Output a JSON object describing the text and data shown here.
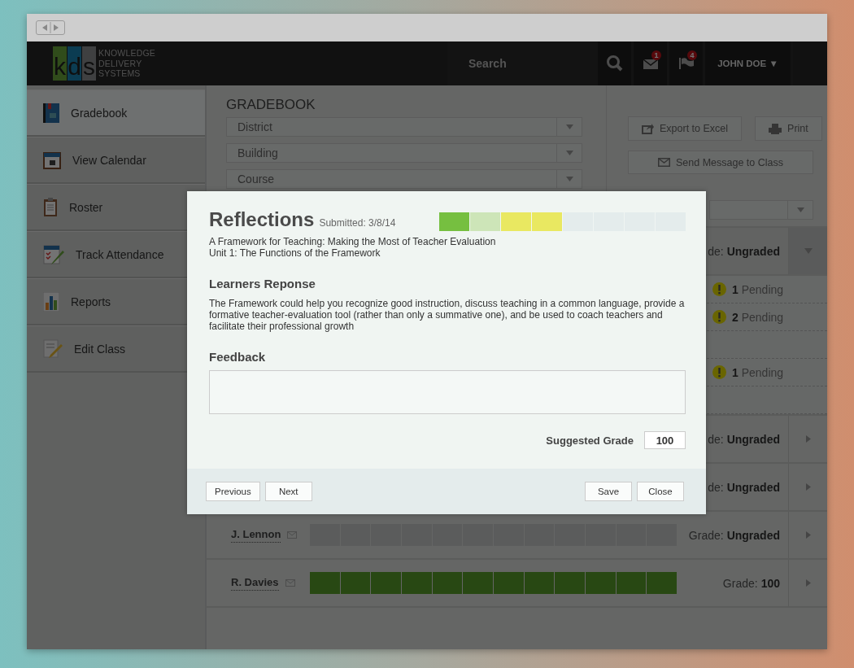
{
  "logo": {
    "letters": [
      "k",
      "d",
      "s"
    ],
    "tagline": [
      "KNOWLEDGE",
      "DELIVERY",
      "SYSTEMS"
    ]
  },
  "header": {
    "search": {
      "placeholder": "Search"
    },
    "messages_badge": "1",
    "flags_badge": "4",
    "user": "JOHN DOE",
    "user_caret": "▼"
  },
  "sidebar": {
    "items": [
      {
        "label": "Gradebook",
        "selected": true
      },
      {
        "label": "View Calendar",
        "selected": false
      },
      {
        "label": "Roster",
        "selected": false
      },
      {
        "label": "Track Attendance",
        "selected": false
      },
      {
        "label": "Reports",
        "selected": false
      },
      {
        "label": "Edit Class",
        "selected": false
      }
    ]
  },
  "gradebook": {
    "title": "GRADEBOOK",
    "filters": [
      {
        "placeholder": "District"
      },
      {
        "placeholder": "Building"
      },
      {
        "placeholder": "Course"
      }
    ],
    "actions": [
      {
        "label": "Export to Excel"
      },
      {
        "label": "Print"
      },
      {
        "label": "Send Message to Class"
      }
    ]
  },
  "students": [
    {
      "grade_label": "de:",
      "grade": "Ungraded",
      "expanded": true,
      "items": [
        {
          "kind": "pending",
          "count": "1",
          "label": "Pending"
        },
        {
          "kind": "pending",
          "count": "2",
          "label": "Pending"
        },
        {
          "kind": "empty"
        },
        {
          "kind": "pending",
          "count": "1",
          "label": "Pending"
        },
        {
          "kind": "empty"
        }
      ]
    },
    {
      "grade_label": "de:",
      "grade": "Ungraded",
      "expanded": false
    },
    {
      "grade_label": "de:",
      "grade": "Ungraded",
      "expanded": false
    },
    {
      "name": "J. Lennon",
      "level": 0,
      "grade_label": "Grade:",
      "grade": "Ungraded",
      "expanded": false
    },
    {
      "name": "R. Davies",
      "level": 1,
      "grade_label": "Grade:",
      "grade": "100",
      "expanded": false
    }
  ],
  "modal": {
    "title": "Reflections",
    "submitted": "Submitted: 3/8/14",
    "progress": [
      {
        "color": "#76bf40"
      },
      {
        "color": "#cde5b8"
      },
      {
        "color": "#e9e861"
      },
      {
        "color": "#e9e861"
      },
      {
        "color": "#e4ecec"
      },
      {
        "color": "#e4ecec"
      },
      {
        "color": "#e4ecec"
      },
      {
        "color": "#e4ecec"
      }
    ],
    "course": "A Framework for Teaching: Making the Most of Teacher Evaluation",
    "unit": "Unit 1: The Functions of the Framework",
    "response_heading": "Learners Reponse",
    "response": "The Framework could help you recognize good instruction, discuss teaching in a common language, provide a formative teacher-evaluation tool (rather than only a summative one), and be used to coach teachers and facilitate their professional growth",
    "feedback_heading": "Feedback",
    "suggested_grade": {
      "label": "Suggested Grade",
      "value": "100"
    },
    "buttons_left": [
      "Previous",
      "Next"
    ],
    "buttons_right": [
      "Save",
      "Close"
    ]
  }
}
